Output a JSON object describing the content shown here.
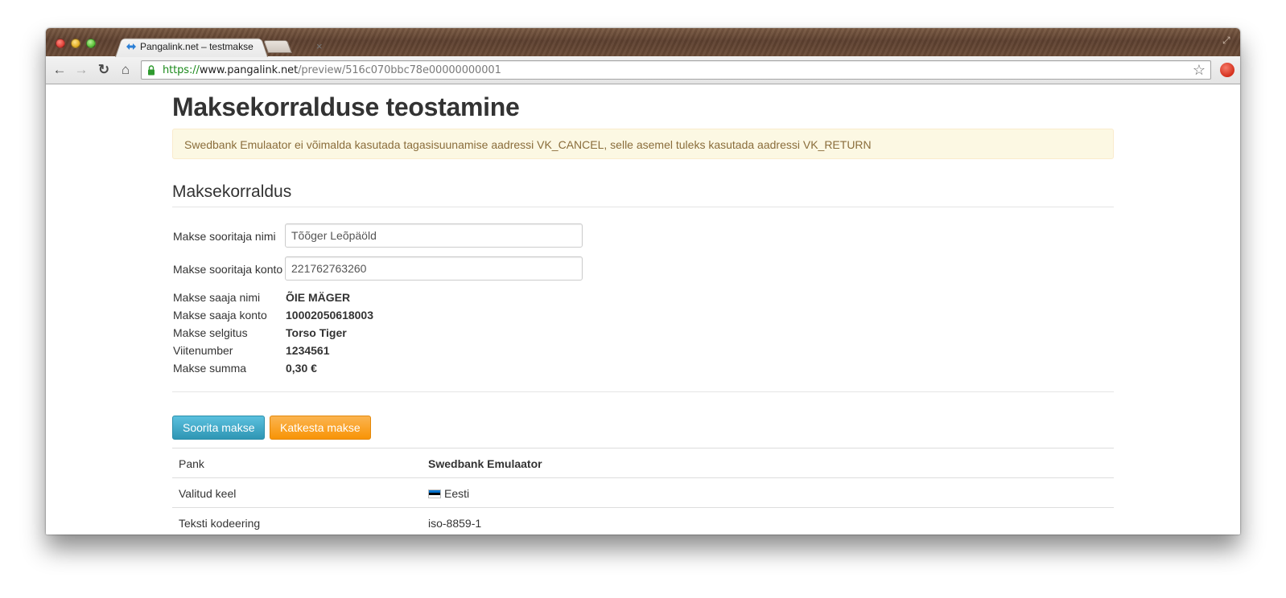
{
  "browser": {
    "tab_title": "Pangalink.net – testmakse",
    "tab_close": "×",
    "url": {
      "scheme": "https://",
      "host": "www.pangalink.net",
      "path": "/preview/516c070bbc78e00000000001"
    }
  },
  "page": {
    "title": "Maksekorralduse teostamine",
    "alert": "Swedbank Emulaator ei võimalda kasutada tagasisuunamise aadressi VK_CANCEL, selle asemel tuleks kasutada aadressi VK_RETURN",
    "section_title": "Maksekorraldus"
  },
  "form": {
    "payer_name": {
      "label": "Makse sooritaja nimi",
      "value": "Tõõger Leõpäöld"
    },
    "payer_account": {
      "label": "Makse sooritaja konto",
      "value": "221762763260"
    }
  },
  "details": [
    {
      "label": "Makse saaja nimi",
      "value": "ÕIE MÄGER"
    },
    {
      "label": "Makse saaja konto",
      "value": "10002050618003"
    },
    {
      "label": "Makse selgitus",
      "value": "Torso Tiger"
    },
    {
      "label": "Viitenumber",
      "value": "1234561"
    },
    {
      "label": "Makse summa",
      "value": "0,30 €"
    }
  ],
  "buttons": {
    "submit": "Soorita makse",
    "cancel": "Katkesta makse"
  },
  "table": [
    {
      "label": "Pank",
      "value": "Swedbank Emulaator"
    },
    {
      "label": "Valitud keel",
      "value": "Eesti",
      "icon": "estonian-flag-icon"
    },
    {
      "label": "Teksti kodeering",
      "value": "iso-8859-1"
    }
  ],
  "colors": {
    "alert_bg": "#fcf8e3",
    "alert_text": "#8a6d3b",
    "btn_info": "#49afcd",
    "btn_warning": "#f89406",
    "url_scheme": "#1b8a1b"
  }
}
